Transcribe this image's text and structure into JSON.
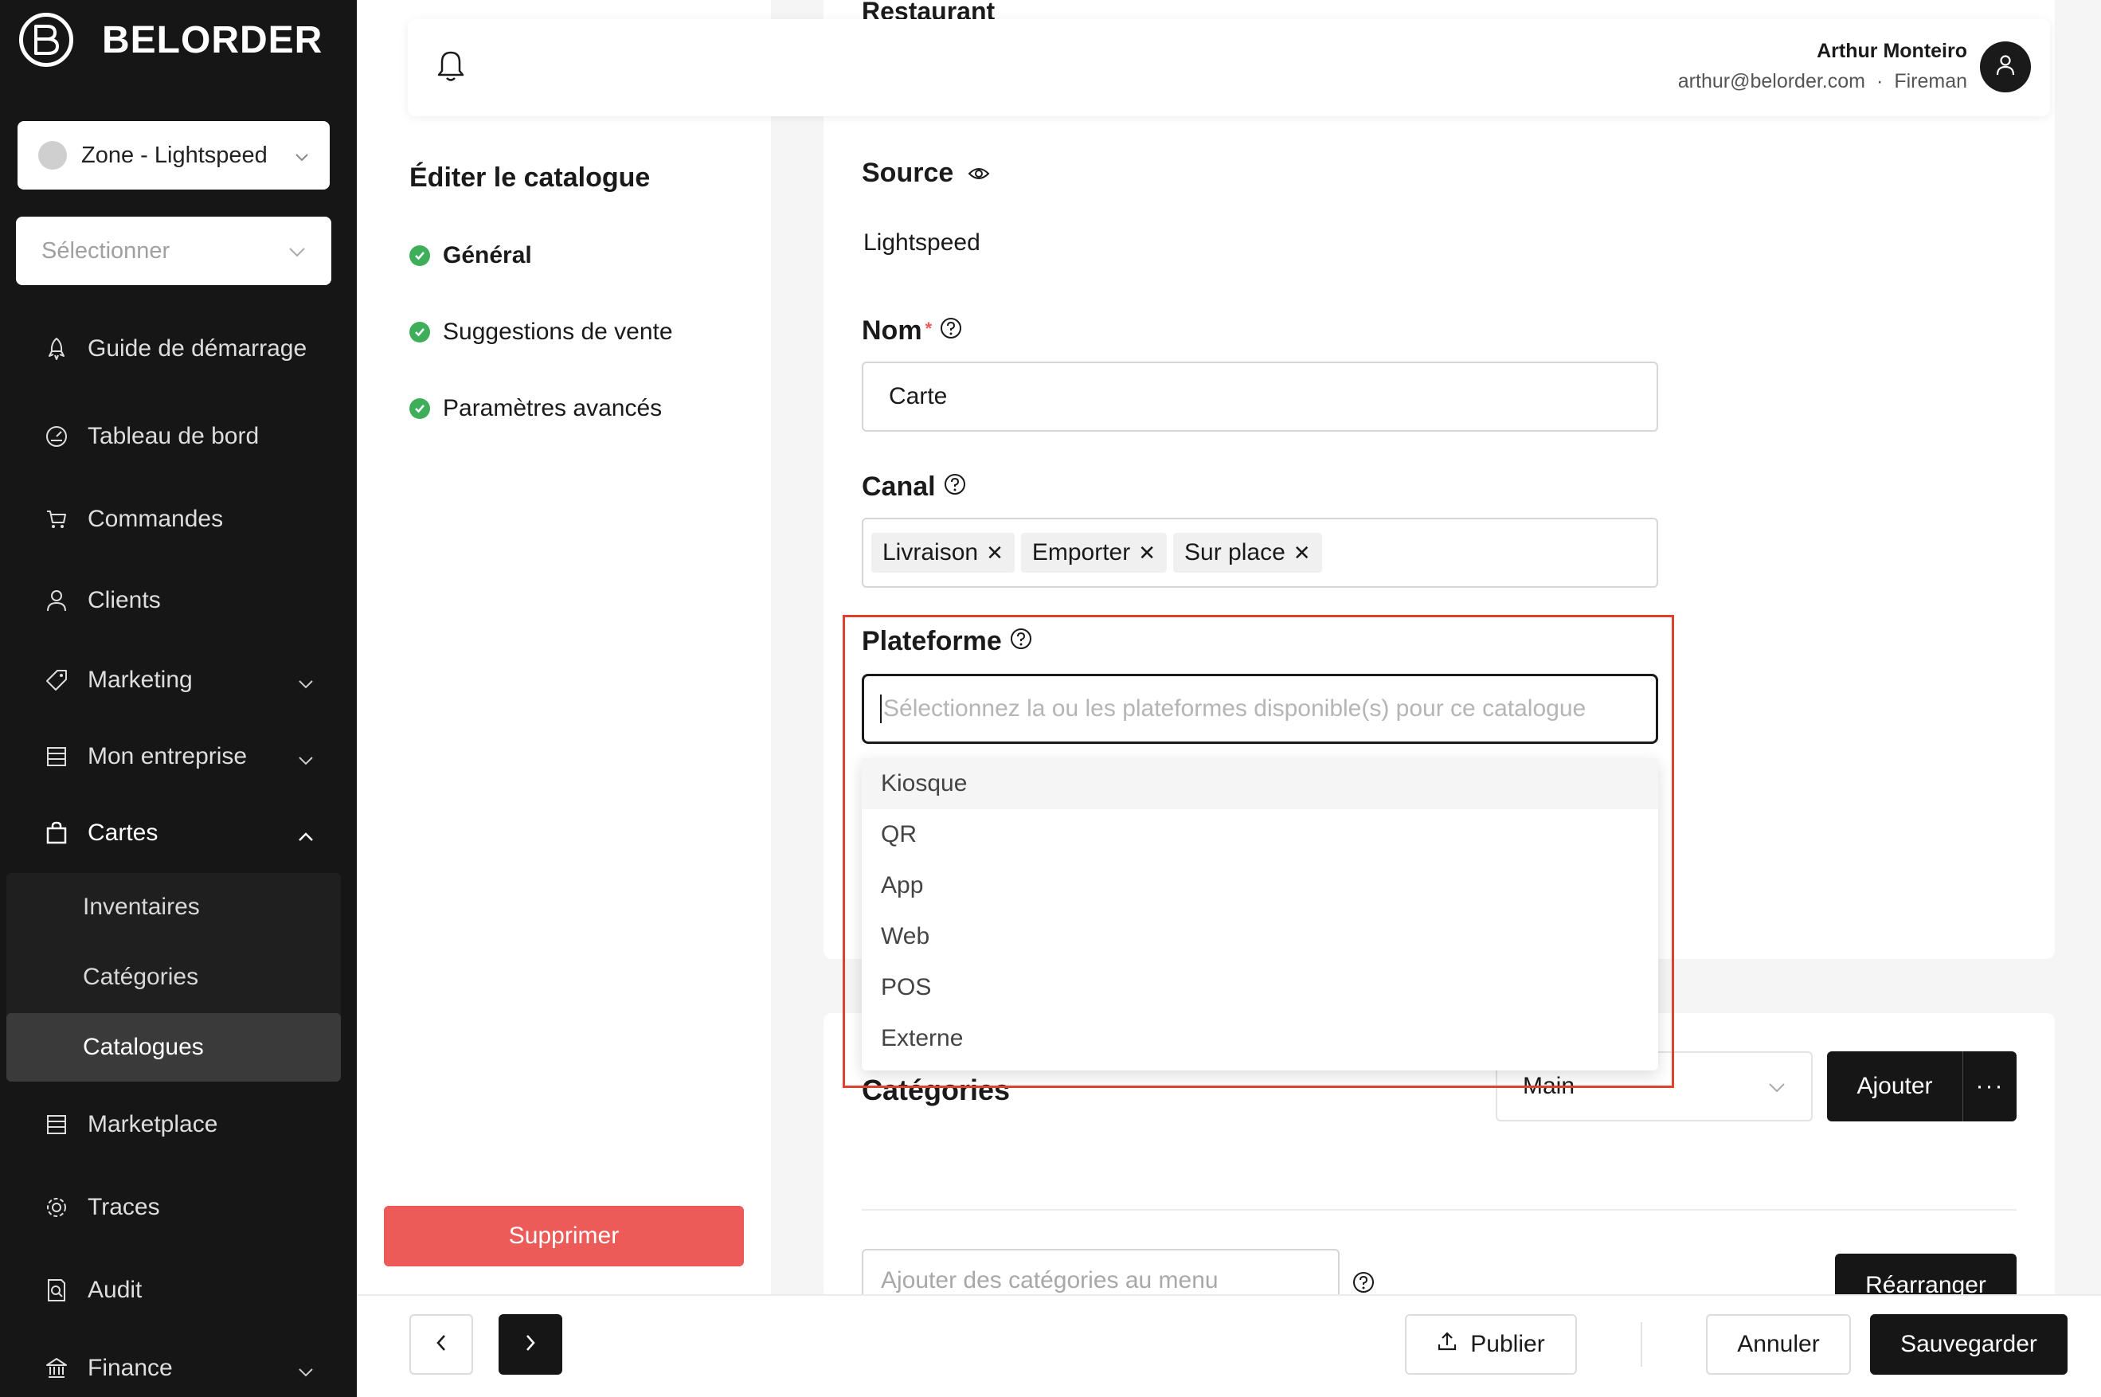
{
  "brand": {
    "name": "BELORDER"
  },
  "sidebar": {
    "zone_select": "Zone - Lightspeed",
    "select_placeholder": "Sélectionner",
    "items": [
      {
        "label": "Guide de démarrage",
        "icon": "rocket-icon"
      },
      {
        "label": "Tableau de bord",
        "icon": "dashboard-icon"
      },
      {
        "label": "Commandes",
        "icon": "cart-icon"
      },
      {
        "label": "Clients",
        "icon": "user-icon"
      },
      {
        "label": "Marketing",
        "icon": "tag-icon"
      },
      {
        "label": "Mon entreprise",
        "icon": "store-icon"
      },
      {
        "label": "Cartes",
        "icon": "bag-icon"
      },
      {
        "label": "Marketplace",
        "icon": "store-icon"
      },
      {
        "label": "Traces",
        "icon": "gear-icon"
      },
      {
        "label": "Audit",
        "icon": "audit-icon"
      },
      {
        "label": "Finance",
        "icon": "bank-icon"
      }
    ],
    "cartes_submenu": [
      "Inventaires",
      "Catégories",
      "Catalogues"
    ],
    "selected_submenu": "Catalogues"
  },
  "header": {
    "user_name": "Arthur Monteiro",
    "user_email": "arthur@belorder.com",
    "user_role": "Fireman"
  },
  "steps": {
    "title": "Éditer le catalogue",
    "items": [
      "Général",
      "Suggestions de vente",
      "Paramètres avancés"
    ],
    "delete_label": "Supprimer"
  },
  "form": {
    "cut_title": "Restaurant",
    "source_label": "Source",
    "source_value": "Lightspeed",
    "name_label": "Nom",
    "name_required": "*",
    "name_value": "Carte",
    "channel_label": "Canal",
    "channels": [
      "Livraison",
      "Emporter",
      "Sur place"
    ],
    "platform_label": "Plateforme",
    "platform_placeholder": "Sélectionnez la ou les plateformes disponible(s) pour ce catalogue",
    "platform_options": [
      "Kiosque",
      "QR",
      "App",
      "Web",
      "POS",
      "Externe"
    ],
    "platform_hovered": "Kiosque"
  },
  "categories": {
    "title": "Catégories",
    "menu_select": "Main",
    "add_label": "Ajouter",
    "more_label": "···",
    "add_placeholder": "Ajouter des catégories au menu",
    "rearrange_label": "Réarranger"
  },
  "bottom": {
    "publish_label": "Publier",
    "cancel_label": "Annuler",
    "save_label": "Sauvegarder"
  },
  "colors": {
    "sidebar_bg": "#161616",
    "danger": "#ec5b58",
    "success": "#3fae5b",
    "highlight": "#e0412d"
  }
}
